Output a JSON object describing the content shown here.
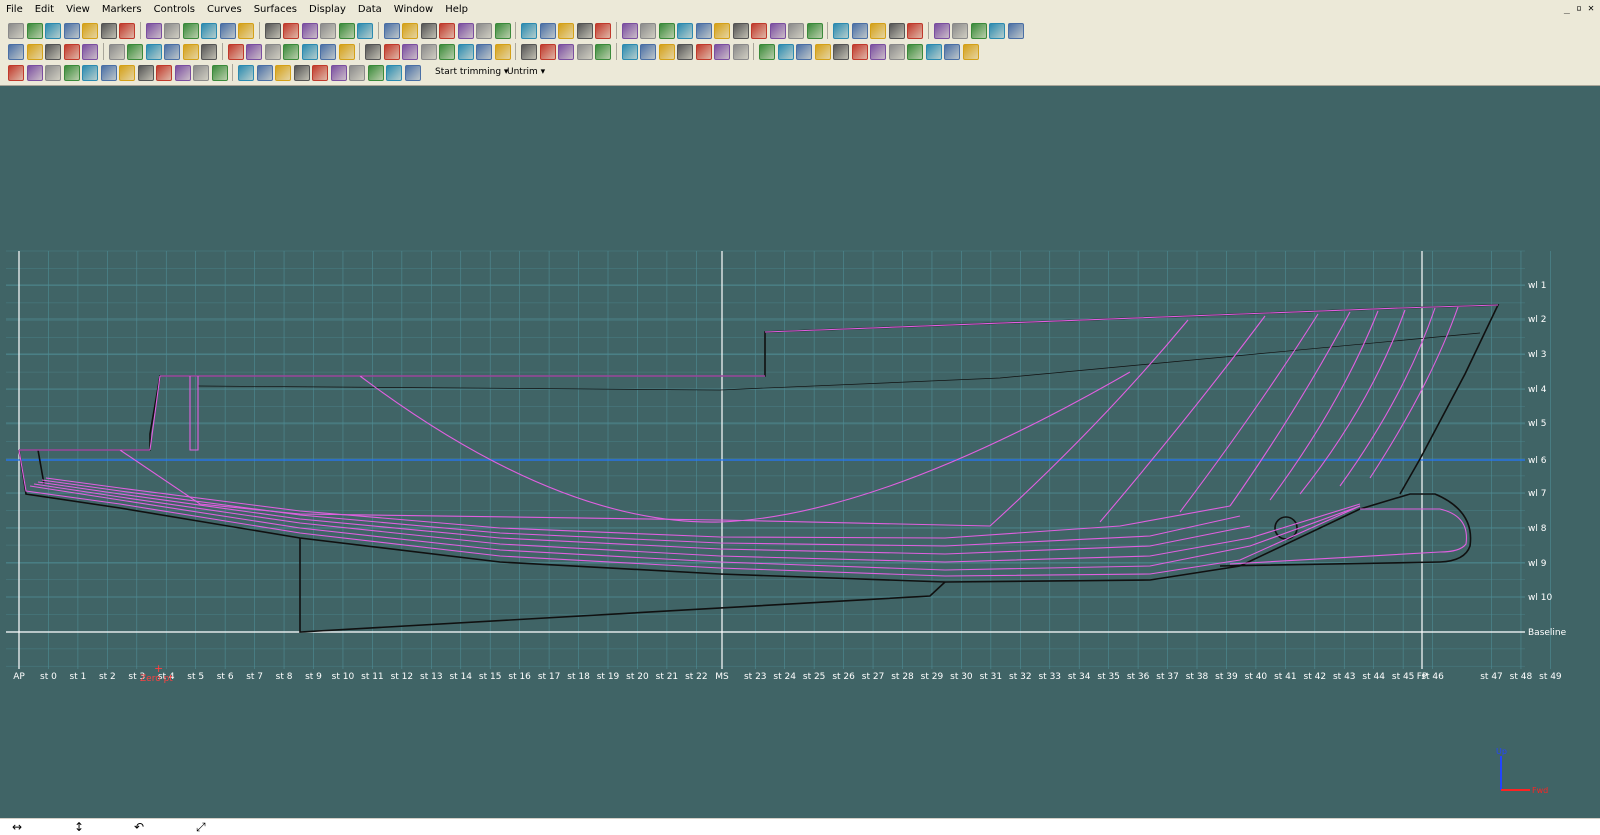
{
  "menu": [
    "File",
    "Edit",
    "View",
    "Markers",
    "Controls",
    "Curves",
    "Surfaces",
    "Display",
    "Data",
    "Window",
    "Help"
  ],
  "window_controls": [
    "_",
    "▫",
    "✕"
  ],
  "toolbar": {
    "start_trimming_label": "Start trimming",
    "untrim_label": "Untrim"
  },
  "waterlines": [
    "wl 1",
    "wl 2",
    "wl 3",
    "wl 4",
    "wl 5",
    "wl 6",
    "wl 7",
    "wl 8",
    "wl 9",
    "wl 10",
    "Baseline"
  ],
  "stations": [
    "AP",
    "st 0",
    "st 1",
    "st 2",
    "st 3",
    "st 4",
    "st 5",
    "st 6",
    "st 7",
    "st 8",
    "st 9",
    "st 10",
    "st 11",
    "st 12",
    "st 13",
    "st 14",
    "st 15",
    "st 16",
    "st 17",
    "st 18",
    "st 19",
    "st 20",
    "st 21",
    "st 22",
    "MS",
    "st 23",
    "st 24",
    "st 25",
    "st 26",
    "st 27",
    "st 28",
    "st 29",
    "st 30",
    "st 31",
    "st 32",
    "st 33",
    "st 34",
    "st 35",
    "st 36",
    "st 37",
    "st 38",
    "st 39",
    "st 40",
    "st 41",
    "st 42",
    "st 43",
    "st 44",
    "st 45",
    "st 46",
    "FP",
    "st 47",
    "st 48",
    "st 49"
  ],
  "cursor_label": "Zero pt",
  "axis_indicator": {
    "up": "Up",
    "fwd": "Fwd"
  },
  "colors": {
    "canvas": "#406466",
    "grid": "#4f8d95",
    "section_line": "#e060e0",
    "hull_line": "#101010",
    "highlight_line": "#2277ff",
    "axis_up": "#2244ff",
    "axis_fwd": "#ff2222"
  },
  "statusbar_icons": [
    "↔",
    "↕",
    "↶",
    "⤢"
  ]
}
